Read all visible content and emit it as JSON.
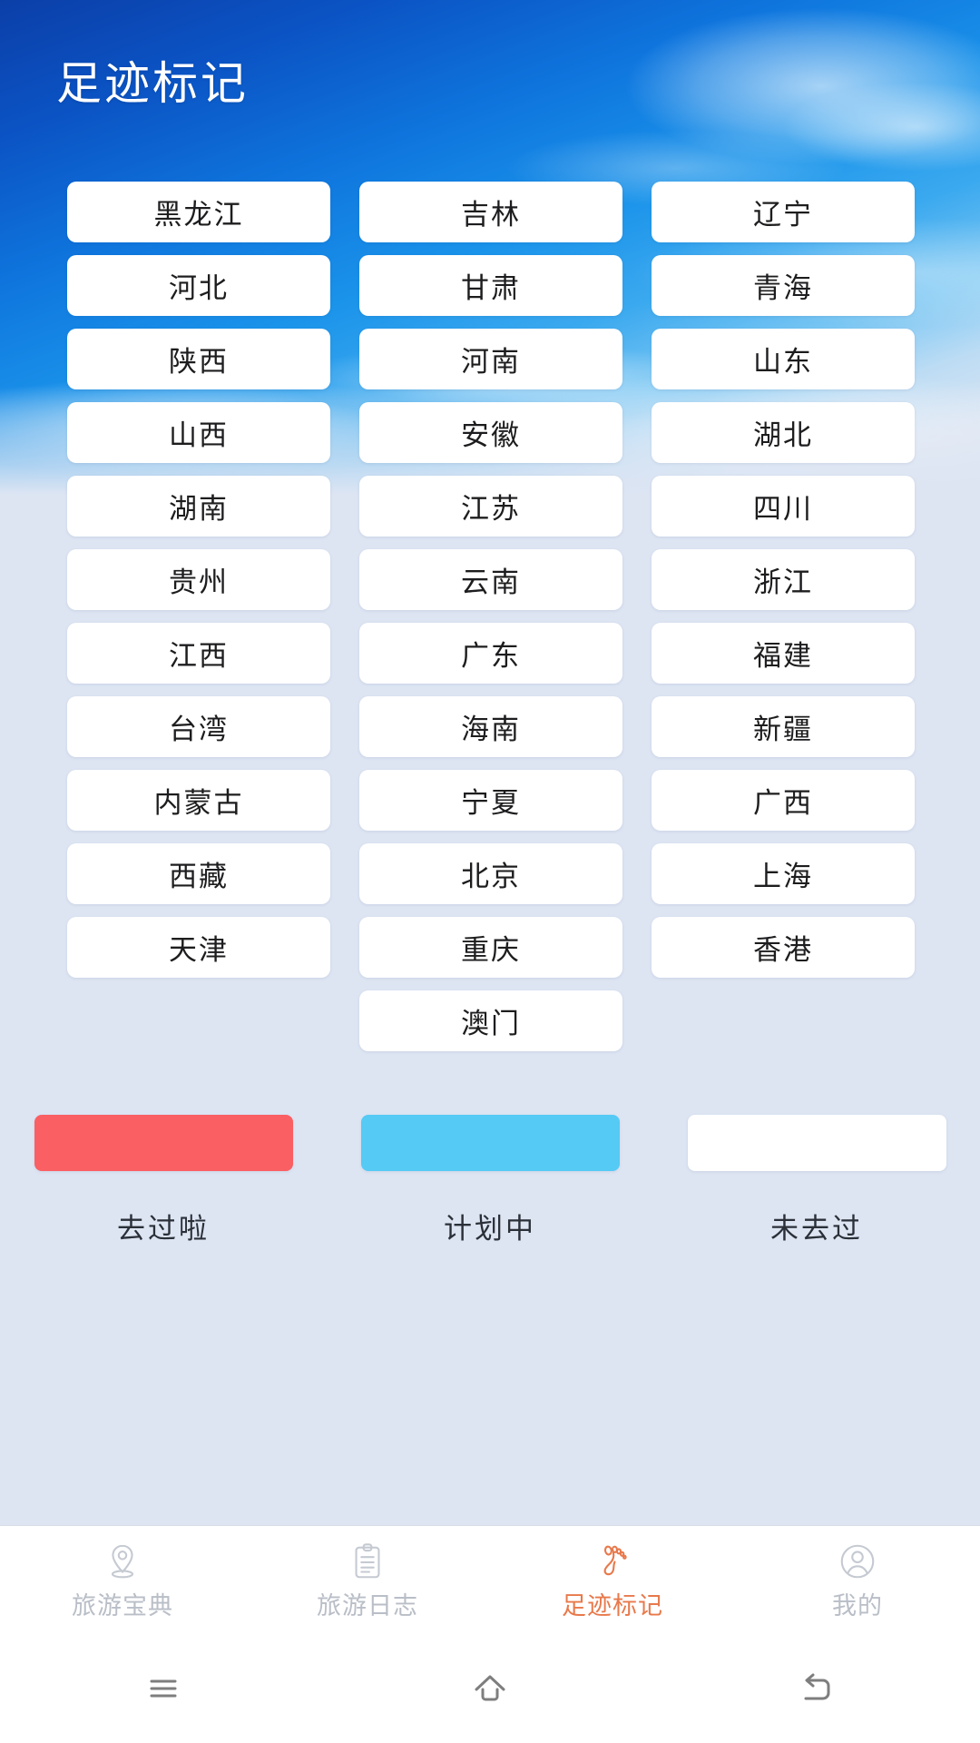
{
  "header": {
    "title": "足迹标记",
    "background_top_color": "#0b3fa8",
    "background_mid_color": "#1a93ea"
  },
  "grid": {
    "provinces": [
      {
        "label": "黑龙江",
        "state": "none"
      },
      {
        "label": "吉林",
        "state": "none"
      },
      {
        "label": "辽宁",
        "state": "none"
      },
      {
        "label": "河北",
        "state": "none"
      },
      {
        "label": "甘肃",
        "state": "none"
      },
      {
        "label": "青海",
        "state": "none"
      },
      {
        "label": "陕西",
        "state": "none"
      },
      {
        "label": "河南",
        "state": "none"
      },
      {
        "label": "山东",
        "state": "none"
      },
      {
        "label": "山西",
        "state": "none"
      },
      {
        "label": "安徽",
        "state": "none"
      },
      {
        "label": "湖北",
        "state": "none"
      },
      {
        "label": "湖南",
        "state": "none"
      },
      {
        "label": "江苏",
        "state": "none"
      },
      {
        "label": "四川",
        "state": "none"
      },
      {
        "label": "贵州",
        "state": "none"
      },
      {
        "label": "云南",
        "state": "none"
      },
      {
        "label": "浙江",
        "state": "none"
      },
      {
        "label": "江西",
        "state": "none"
      },
      {
        "label": "广东",
        "state": "none"
      },
      {
        "label": "福建",
        "state": "none"
      },
      {
        "label": "台湾",
        "state": "none"
      },
      {
        "label": "海南",
        "state": "none"
      },
      {
        "label": "新疆",
        "state": "none"
      },
      {
        "label": "内蒙古",
        "state": "none"
      },
      {
        "label": "宁夏",
        "state": "none"
      },
      {
        "label": "广西",
        "state": "none"
      },
      {
        "label": "西藏",
        "state": "none"
      },
      {
        "label": "北京",
        "state": "none"
      },
      {
        "label": "上海",
        "state": "none"
      },
      {
        "label": "天津",
        "state": "none"
      },
      {
        "label": "重庆",
        "state": "none"
      },
      {
        "label": "香港",
        "state": "none"
      },
      {
        "label": "",
        "state": "blank"
      },
      {
        "label": "澳门",
        "state": "none"
      },
      {
        "label": "",
        "state": "blank"
      }
    ]
  },
  "legend": {
    "items": [
      {
        "label": "去过啦",
        "color": "#FA5F63"
      },
      {
        "label": "计划中",
        "color": "#55CAF5"
      },
      {
        "label": "未去过",
        "color": "#FFFFFF"
      }
    ]
  },
  "tabbar": {
    "active_color": "#e8794b",
    "inactive_color": "#b9bec7",
    "tabs": [
      {
        "label": "旅游宝典",
        "icon": "map-pin-icon",
        "active": false
      },
      {
        "label": "旅游日志",
        "icon": "clipboard-icon",
        "active": false
      },
      {
        "label": "足迹标记",
        "icon": "footprint-icon",
        "active": true
      },
      {
        "label": "我的",
        "icon": "person-icon",
        "active": false
      }
    ]
  },
  "system_nav": {
    "buttons": [
      {
        "name": "recents-button"
      },
      {
        "name": "home-button"
      },
      {
        "name": "back-button"
      }
    ]
  }
}
